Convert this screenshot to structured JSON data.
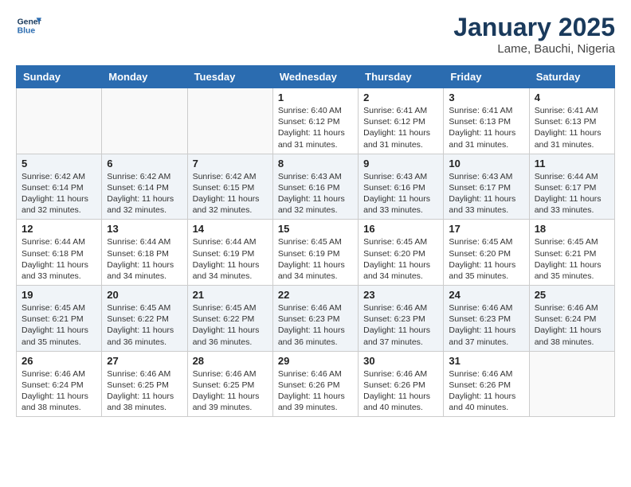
{
  "logo": {
    "line1": "General",
    "line2": "Blue"
  },
  "title": "January 2025",
  "location": "Lame, Bauchi, Nigeria",
  "days_of_week": [
    "Sunday",
    "Monday",
    "Tuesday",
    "Wednesday",
    "Thursday",
    "Friday",
    "Saturday"
  ],
  "weeks": [
    [
      {
        "day": "",
        "info": ""
      },
      {
        "day": "",
        "info": ""
      },
      {
        "day": "",
        "info": ""
      },
      {
        "day": "1",
        "info": "Sunrise: 6:40 AM\nSunset: 6:12 PM\nDaylight: 11 hours\nand 31 minutes."
      },
      {
        "day": "2",
        "info": "Sunrise: 6:41 AM\nSunset: 6:12 PM\nDaylight: 11 hours\nand 31 minutes."
      },
      {
        "day": "3",
        "info": "Sunrise: 6:41 AM\nSunset: 6:13 PM\nDaylight: 11 hours\nand 31 minutes."
      },
      {
        "day": "4",
        "info": "Sunrise: 6:41 AM\nSunset: 6:13 PM\nDaylight: 11 hours\nand 31 minutes."
      }
    ],
    [
      {
        "day": "5",
        "info": "Sunrise: 6:42 AM\nSunset: 6:14 PM\nDaylight: 11 hours\nand 32 minutes."
      },
      {
        "day": "6",
        "info": "Sunrise: 6:42 AM\nSunset: 6:14 PM\nDaylight: 11 hours\nand 32 minutes."
      },
      {
        "day": "7",
        "info": "Sunrise: 6:42 AM\nSunset: 6:15 PM\nDaylight: 11 hours\nand 32 minutes."
      },
      {
        "day": "8",
        "info": "Sunrise: 6:43 AM\nSunset: 6:16 PM\nDaylight: 11 hours\nand 32 minutes."
      },
      {
        "day": "9",
        "info": "Sunrise: 6:43 AM\nSunset: 6:16 PM\nDaylight: 11 hours\nand 33 minutes."
      },
      {
        "day": "10",
        "info": "Sunrise: 6:43 AM\nSunset: 6:17 PM\nDaylight: 11 hours\nand 33 minutes."
      },
      {
        "day": "11",
        "info": "Sunrise: 6:44 AM\nSunset: 6:17 PM\nDaylight: 11 hours\nand 33 minutes."
      }
    ],
    [
      {
        "day": "12",
        "info": "Sunrise: 6:44 AM\nSunset: 6:18 PM\nDaylight: 11 hours\nand 33 minutes."
      },
      {
        "day": "13",
        "info": "Sunrise: 6:44 AM\nSunset: 6:18 PM\nDaylight: 11 hours\nand 34 minutes."
      },
      {
        "day": "14",
        "info": "Sunrise: 6:44 AM\nSunset: 6:19 PM\nDaylight: 11 hours\nand 34 minutes."
      },
      {
        "day": "15",
        "info": "Sunrise: 6:45 AM\nSunset: 6:19 PM\nDaylight: 11 hours\nand 34 minutes."
      },
      {
        "day": "16",
        "info": "Sunrise: 6:45 AM\nSunset: 6:20 PM\nDaylight: 11 hours\nand 34 minutes."
      },
      {
        "day": "17",
        "info": "Sunrise: 6:45 AM\nSunset: 6:20 PM\nDaylight: 11 hours\nand 35 minutes."
      },
      {
        "day": "18",
        "info": "Sunrise: 6:45 AM\nSunset: 6:21 PM\nDaylight: 11 hours\nand 35 minutes."
      }
    ],
    [
      {
        "day": "19",
        "info": "Sunrise: 6:45 AM\nSunset: 6:21 PM\nDaylight: 11 hours\nand 35 minutes."
      },
      {
        "day": "20",
        "info": "Sunrise: 6:45 AM\nSunset: 6:22 PM\nDaylight: 11 hours\nand 36 minutes."
      },
      {
        "day": "21",
        "info": "Sunrise: 6:45 AM\nSunset: 6:22 PM\nDaylight: 11 hours\nand 36 minutes."
      },
      {
        "day": "22",
        "info": "Sunrise: 6:46 AM\nSunset: 6:23 PM\nDaylight: 11 hours\nand 36 minutes."
      },
      {
        "day": "23",
        "info": "Sunrise: 6:46 AM\nSunset: 6:23 PM\nDaylight: 11 hours\nand 37 minutes."
      },
      {
        "day": "24",
        "info": "Sunrise: 6:46 AM\nSunset: 6:23 PM\nDaylight: 11 hours\nand 37 minutes."
      },
      {
        "day": "25",
        "info": "Sunrise: 6:46 AM\nSunset: 6:24 PM\nDaylight: 11 hours\nand 38 minutes."
      }
    ],
    [
      {
        "day": "26",
        "info": "Sunrise: 6:46 AM\nSunset: 6:24 PM\nDaylight: 11 hours\nand 38 minutes."
      },
      {
        "day": "27",
        "info": "Sunrise: 6:46 AM\nSunset: 6:25 PM\nDaylight: 11 hours\nand 38 minutes."
      },
      {
        "day": "28",
        "info": "Sunrise: 6:46 AM\nSunset: 6:25 PM\nDaylight: 11 hours\nand 39 minutes."
      },
      {
        "day": "29",
        "info": "Sunrise: 6:46 AM\nSunset: 6:26 PM\nDaylight: 11 hours\nand 39 minutes."
      },
      {
        "day": "30",
        "info": "Sunrise: 6:46 AM\nSunset: 6:26 PM\nDaylight: 11 hours\nand 40 minutes."
      },
      {
        "day": "31",
        "info": "Sunrise: 6:46 AM\nSunset: 6:26 PM\nDaylight: 11 hours\nand 40 minutes."
      },
      {
        "day": "",
        "info": ""
      }
    ]
  ]
}
